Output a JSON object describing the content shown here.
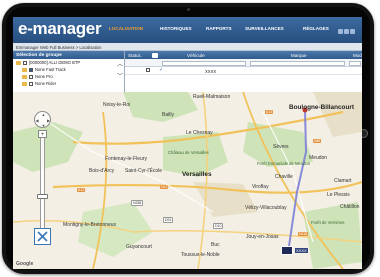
{
  "app": {
    "logo": "e-manager",
    "nav": [
      {
        "label": "LOCALISATION",
        "active": true
      },
      {
        "label": "HISTORIQUES",
        "active": false
      },
      {
        "label": "RAPPORTS",
        "active": false
      },
      {
        "label": "SURVEILLANCES",
        "active": false
      },
      {
        "label": "RÉGLAGES",
        "active": false
      }
    ],
    "breadcrumb": "Emmanager Web Full Business > Localisation"
  },
  "groups": {
    "title": "Sélection de groupe",
    "items": [
      "[0000000] ALLI DEMO BTP",
      "None Fast Track",
      "None Pro",
      "None Rider"
    ]
  },
  "grid": {
    "columns": [
      "Statut..",
      "Véhicule",
      "Marque",
      "Mod"
    ],
    "rows": [
      {
        "vehicle": "XXXX"
      }
    ]
  },
  "map": {
    "places": {
      "boulogne": "Boulogne-Billancourt",
      "versailles": "Versailles",
      "velizy": "Vélizy-Villacoublay",
      "le_chesnay": "Le Chesnay",
      "meudon": "Meudon",
      "sevres": "Sèvres",
      "chaville": "Chaville",
      "viroflay": "Viroflay",
      "clamart": "Clamart",
      "guyancourt": "Guyancourt",
      "buc": "Buc",
      "jouy": "Jouy-en-Josas",
      "fontenay": "Fontenay-le-Fleury",
      "saint_cyr": "Saint-Cyr-l'École",
      "bois_arcy": "Bois-d'Arcy",
      "montigny": "Montigny-le-Bretonneux",
      "chatillon": "Châtillon",
      "plessis": "Le Plessis",
      "toussus": "Toussus-le-Noble",
      "noisy": "Noisy-le-Roi",
      "bailly": "Bailly",
      "rueil": "Rueil-Malmaison",
      "chateau": "Château de Versailles",
      "foret_meudon": "Forêt Domaniale de Meudon",
      "foret_verrieres": "Forêt de Verrières"
    },
    "roads": [
      "N12",
      "A86",
      "A12",
      "N118",
      "D10",
      "D91",
      "N286",
      "A13"
    ],
    "vehicle_label": "XXXX",
    "brand": "Google"
  },
  "colors": {
    "header": "#2e5a8c",
    "nav_active": "#f2a12f",
    "route": "#7b80d6",
    "vehicle": "#1b2a57",
    "road": "#e3913d"
  }
}
